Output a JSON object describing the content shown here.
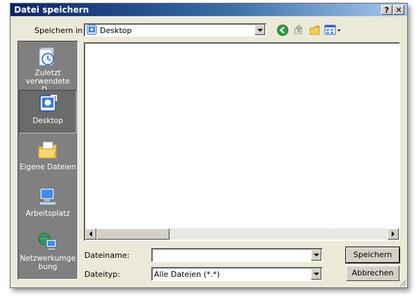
{
  "dialog": {
    "title": "Datei speichern",
    "help_label": "?",
    "close_label": "✕"
  },
  "save_in": {
    "label": "Speichern in:",
    "value": "Desktop"
  },
  "toolbar": {
    "icons": [
      "back-icon",
      "up-folder-icon",
      "new-folder-icon",
      "view-menu-icon"
    ]
  },
  "places": [
    {
      "label": "Zuletzt verwendete D...",
      "icon": "recent-documents-icon"
    },
    {
      "label": "Desktop",
      "icon": "desktop-icon"
    },
    {
      "label": "Eigene Dateien",
      "icon": "my-documents-icon"
    },
    {
      "label": "Arbeitsplatz",
      "icon": "my-computer-icon"
    },
    {
      "label": "Netzwerkumge bung",
      "icon": "network-icon"
    }
  ],
  "filename": {
    "label": "Dateiname:",
    "value": ""
  },
  "filetype": {
    "label": "Dateityp:",
    "value": "Alle Dateien (*.*)"
  },
  "buttons": {
    "save": "Speichern",
    "cancel": "Abbrechen"
  },
  "colors": {
    "title_start": "#0a246a",
    "title_end": "#a6caf0",
    "face": "#ece9d8",
    "places_bar": "#808080"
  }
}
